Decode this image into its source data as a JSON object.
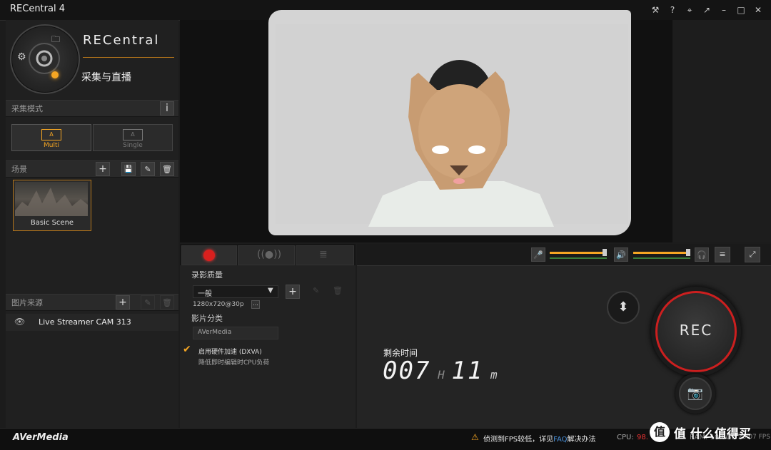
{
  "window": {
    "title": "RECentral 4",
    "controls": [
      "pin-settings",
      "help",
      "pin",
      "back",
      "minimize",
      "maximize",
      "close"
    ]
  },
  "header": {
    "brand": "RECentral",
    "subtitle": "采集与直播"
  },
  "capture_mode": {
    "label": "采集模式",
    "info": "i",
    "options": [
      {
        "icon_text": "A",
        "label": "Multi",
        "selected": true
      },
      {
        "icon_text": "A",
        "label": "Single",
        "selected": false
      }
    ]
  },
  "scenes": {
    "label": "场景",
    "items": [
      {
        "label": "Basic Scene"
      }
    ]
  },
  "sources": {
    "label": "图片来源",
    "items": [
      {
        "label": "Live Streamer CAM 313"
      }
    ]
  },
  "recording": {
    "quality_label": "录影质量",
    "quality_value": "一般",
    "resolution": "1280x720@30p",
    "more": "...",
    "category_label": "影片分类",
    "category_value": "AVerMedia",
    "hw_accel_label": "启用硬件加速 (DXVA)",
    "hw_accel_hint": "降低即时编辑时CPU负荷",
    "hw_accel_checked": true
  },
  "timer": {
    "label": "剩余时间",
    "hours": "007",
    "h_unit": "H",
    "minutes": "11",
    "m_unit": "m"
  },
  "rec_button": {
    "label": "REC"
  },
  "status": {
    "brand": "AVerMedia",
    "warning": "侦测到FPS较低，详见",
    "faq": "FAQ",
    "warning_end": "解决办法",
    "cpu_label": "CPU:",
    "cpu_value": "98.",
    "ram_fragment": "RAM: 10.6GB",
    "fps_fragment": "23.07 FPS"
  },
  "watermark": {
    "text": "值 什么值得买"
  },
  "colors": {
    "accent": "#f5a623",
    "rec_red": "#cc1f1f",
    "background": "#1c1c1c"
  }
}
